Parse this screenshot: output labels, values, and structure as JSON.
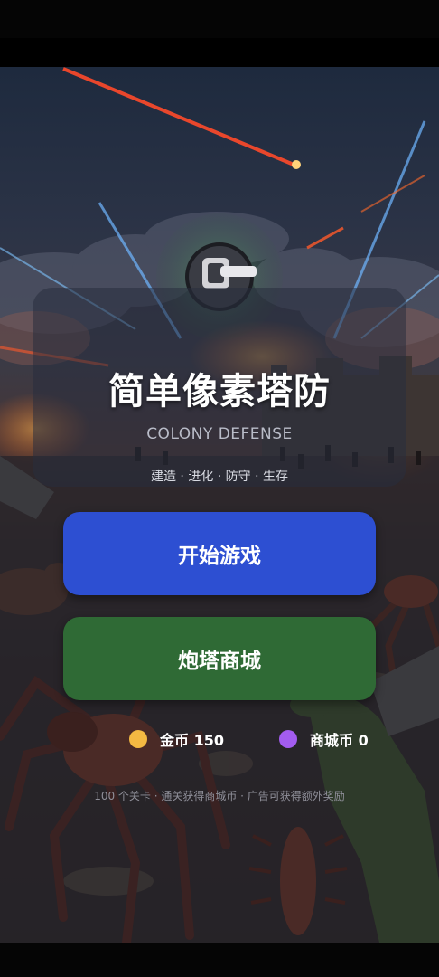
{
  "title": "简单像素塔防",
  "subtitle": "COLONY DEFENSE",
  "tagline": "建造 · 进化 · 防守 · 生存",
  "buttons": {
    "start_label": "开始游戏",
    "shop_label": "炮塔商城"
  },
  "currency": {
    "gold_label": "金币 150",
    "shop_coin_label": "商城币 0"
  },
  "footer_note": "100 个关卡 · 通关获得商城币 · 广告可获得额外奖励",
  "icons": {
    "logo": "turret-icon",
    "gold": "gold-coin-icon",
    "shop_coin": "shop-coin-icon"
  },
  "colors": {
    "start_button": "#2d4fd2",
    "shop_button": "#2f6a35",
    "gold_coin": "#f4b942",
    "shop_coin": "#a35cf0"
  }
}
